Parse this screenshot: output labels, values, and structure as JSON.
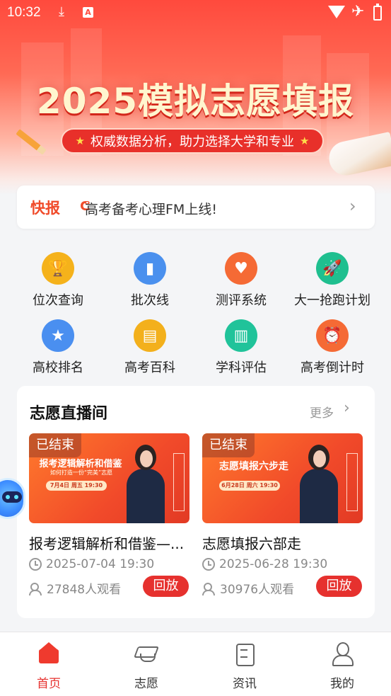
{
  "status_bar": {
    "time": "10:32"
  },
  "hero": {
    "title": "2025模拟志愿填报",
    "subtitle": "权威数据分析，助力选择大学和专业"
  },
  "ticker": {
    "tag": "快报",
    "message": "高考备考心理FM上线!"
  },
  "features": [
    {
      "label": "位次查询",
      "icon": "trophy-icon",
      "color": "#f5b21b"
    },
    {
      "label": "批次线",
      "icon": "bar-chart-icon",
      "color": "#4a90ee"
    },
    {
      "label": "测评系统",
      "icon": "heart-icon",
      "color": "#f56a35"
    },
    {
      "label": "大一抢跑计划",
      "icon": "rocket-icon",
      "color": "#1fbf8f"
    },
    {
      "label": "高校排名",
      "icon": "medal-icon",
      "color": "#4a8ff0"
    },
    {
      "label": "高考百科",
      "icon": "book-icon",
      "color": "#f3b01c"
    },
    {
      "label": "学科评估",
      "icon": "open-book-icon",
      "color": "#20c39a"
    },
    {
      "label": "高考倒计时",
      "icon": "alarm-clock-icon",
      "color": "#f56a35"
    }
  ],
  "live_room": {
    "title": "志愿直播间",
    "more_label": "更多",
    "videos": [
      {
        "status": "已结束",
        "thumb_headline": "报考逻辑解析和借鉴",
        "thumb_subline": "如何打造一份“完美”志愿",
        "thumb_pill": "7月4日 周五 19:30",
        "title": "报考逻辑解析和借鉴—...",
        "time": "2025-07-04 19:30",
        "views": "27848人观看",
        "replay_label": "回放"
      },
      {
        "status": "已结束",
        "thumb_headline": "志愿填报六步走",
        "thumb_subline": "",
        "thumb_pill": "6月28日 周六 19:30",
        "title": "志愿填报六部走",
        "time": "2025-06-28 19:30",
        "views": "30976人观看",
        "replay_label": "回放"
      }
    ]
  },
  "bottom_nav": {
    "tabs": [
      {
        "label": "首页",
        "icon": "home-icon",
        "active": true
      },
      {
        "label": "志愿",
        "icon": "graduation-cap-icon",
        "active": false
      },
      {
        "label": "资讯",
        "icon": "news-icon",
        "active": false
      },
      {
        "label": "我的",
        "icon": "user-icon",
        "active": false
      }
    ]
  },
  "colors": {
    "brand_red": "#e6312e",
    "hero_red": "#ff4a3d",
    "text_gray": "#888888"
  }
}
